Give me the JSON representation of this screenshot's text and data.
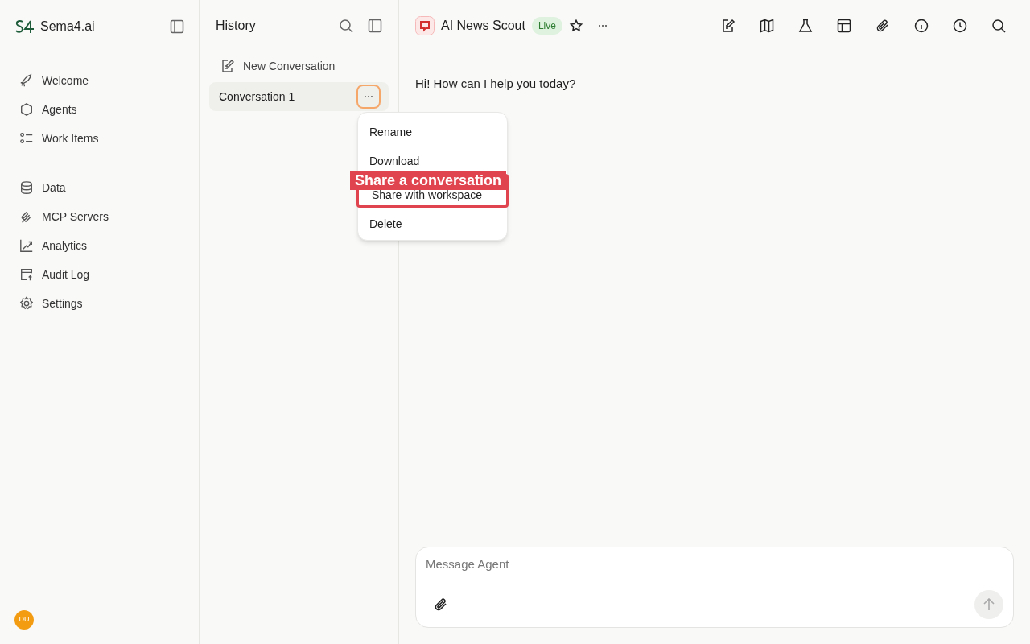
{
  "brand": {
    "name": "Sema4.ai"
  },
  "nav_groups": [
    [
      {
        "label": "Welcome"
      },
      {
        "label": "Agents"
      },
      {
        "label": "Work Items"
      }
    ],
    [
      {
        "label": "Data"
      },
      {
        "label": "MCP Servers"
      },
      {
        "label": "Analytics"
      },
      {
        "label": "Audit Log"
      },
      {
        "label": "Settings"
      }
    ]
  ],
  "user": {
    "initials": "DU"
  },
  "history": {
    "title": "History",
    "new_conversation": "New Conversation",
    "conversations": [
      {
        "label": "Conversation 1",
        "selected": true,
        "menu_open": true
      }
    ],
    "menu": [
      {
        "label": "Rename",
        "highlighted": false
      },
      {
        "label": "Download",
        "highlighted": false
      },
      {
        "label": "Share with workspace",
        "highlighted": true
      },
      {
        "label": "Delete",
        "highlighted": false
      }
    ]
  },
  "annotation": {
    "label": "Share a conversation"
  },
  "agent": {
    "name": "AI News Scout",
    "status": "Live",
    "starred": false
  },
  "messages": [
    {
      "text": "Hi! How can I help you today?"
    }
  ],
  "composer": {
    "placeholder": "Message Agent"
  }
}
